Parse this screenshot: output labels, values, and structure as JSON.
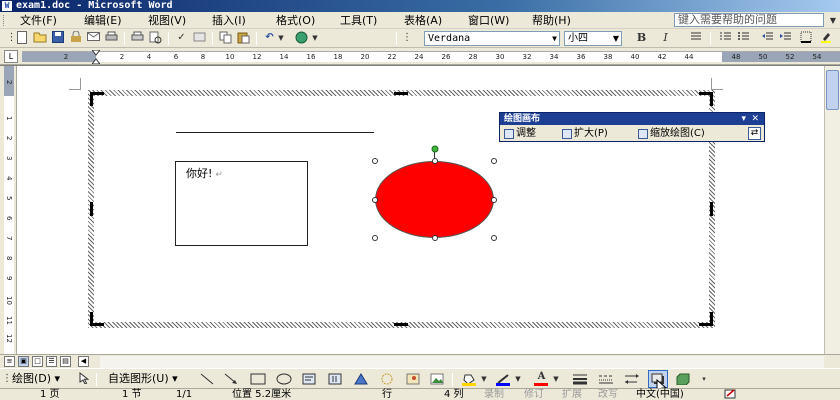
{
  "window": {
    "title": "exam1.doc - Microsoft Word"
  },
  "menu": {
    "items": [
      "文件(F)",
      "编辑(E)",
      "视图(V)",
      "插入(I)",
      "格式(O)",
      "工具(T)",
      "表格(A)",
      "窗口(W)",
      "帮助(H)"
    ],
    "help_placeholder": "键入需要帮助的问题"
  },
  "format": {
    "font_name": "Verdana",
    "font_size": "小四",
    "bold": "B",
    "italic": "I"
  },
  "ruler": {
    "ticks": [
      "2",
      "2",
      "4",
      "6",
      "8",
      "10",
      "12",
      "14",
      "16",
      "18",
      "20",
      "22",
      "24",
      "26",
      "28",
      "30",
      "32",
      "34",
      "36",
      "38",
      "40",
      "42",
      "44",
      "48",
      "50",
      "52",
      "54"
    ],
    "vticks": [
      "2",
      "1",
      "2",
      "3",
      "4",
      "5",
      "6",
      "7",
      "8",
      "9",
      "10",
      "11",
      "12",
      "13"
    ]
  },
  "document": {
    "textbox_text": "你好!",
    "shape_fill": "#ff0000"
  },
  "canvas_toolbar": {
    "title": "绘图画布",
    "fit": "调整",
    "expand": "扩大(P)",
    "scale": "缩放绘图(C)"
  },
  "drawing_toolbar": {
    "draw": "绘图(D)",
    "autoshapes": "自选图形(U)",
    "fill_color": "#ffd700",
    "line_color": "#0000ff",
    "font_color": "#ff0000"
  },
  "status": {
    "page": "1 页",
    "section": "1 节",
    "page_of": "1/1",
    "position": "位置 5.2厘米",
    "line": "行",
    "column": "4 列",
    "rec": "录制",
    "trk": "修订",
    "ext": "扩展",
    "ovr": "改写",
    "language": "中文(中国)"
  }
}
